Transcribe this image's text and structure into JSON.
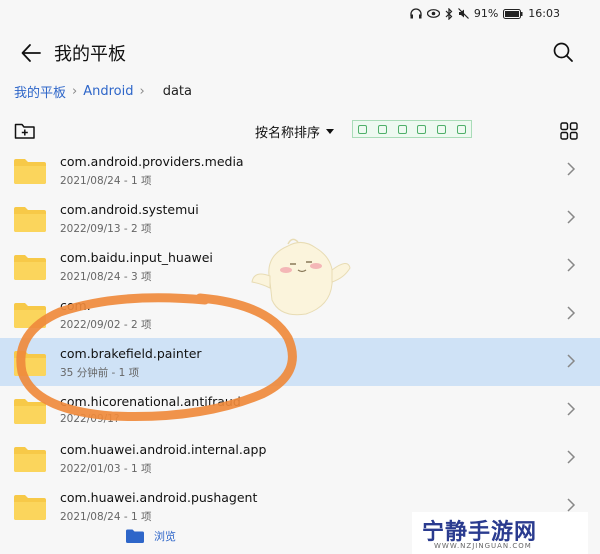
{
  "status": {
    "battery": "91%",
    "time": "16:03"
  },
  "header": {
    "title": "我的平板"
  },
  "breadcrumb": {
    "items": [
      "我的平板",
      "Android",
      "data"
    ]
  },
  "toolbar": {
    "sort_label": "按名称排序"
  },
  "files": [
    {
      "name": "com.android.providers.media",
      "meta": "2021/08/24 - 1 项"
    },
    {
      "name": "com.android.systemui",
      "meta": "2022/09/13 - 2 项"
    },
    {
      "name": "com.baidu.input_huawei",
      "meta": "2021/08/24 - 3 项"
    },
    {
      "name": "com.",
      "meta": "2022/09/02 - 2 项"
    },
    {
      "name": "com.brakefield.painter",
      "meta": "35 分钟前 - 1 项",
      "selected": true
    },
    {
      "name": "com.hicorenational.antifraud",
      "meta": "2022/09/1?"
    },
    {
      "name": "com.huawei.android.internal.app",
      "meta": "2022/01/03 - 1 项"
    },
    {
      "name": "com.huawei.android.pushagent",
      "meta": "2021/08/24 - 1 项"
    }
  ],
  "bottom": {
    "browse_label": "浏览"
  },
  "watermark": {
    "main": "宁静手游网",
    "sub": "WWW.NZJINGUAN.COM"
  },
  "colors": {
    "accent": "#2e66c9",
    "folder": "#f7c948",
    "selected_row": "#cfe2f6",
    "annotation_ring": "#ef8a3c"
  }
}
